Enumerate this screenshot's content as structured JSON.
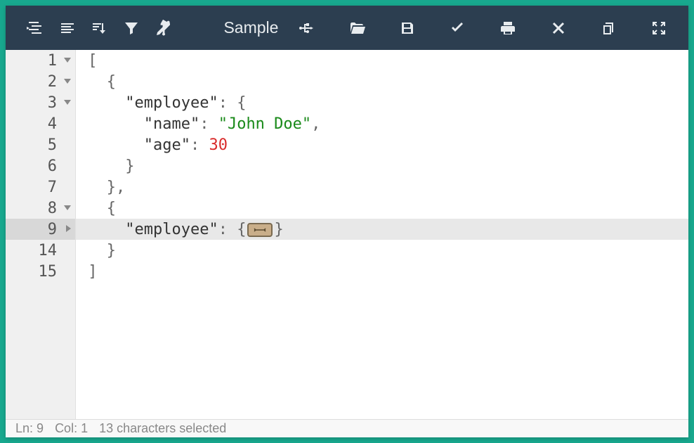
{
  "toolbar": {
    "sample_label": "Sample"
  },
  "editor": {
    "lines": [
      {
        "n": 1,
        "fold": "open"
      },
      {
        "n": 2,
        "fold": "open"
      },
      {
        "n": 3,
        "fold": "open"
      },
      {
        "n": 4,
        "fold": null
      },
      {
        "n": 5,
        "fold": null
      },
      {
        "n": 6,
        "fold": null
      },
      {
        "n": 7,
        "fold": null
      },
      {
        "n": 8,
        "fold": "open"
      },
      {
        "n": 9,
        "fold": "closed",
        "active": true
      },
      {
        "n": 14,
        "fold": null
      },
      {
        "n": 15,
        "fold": null
      }
    ],
    "tok": {
      "l1_bracket": "[",
      "l2_brace": "{",
      "l3_key": "\"employee\"",
      "l3_colon": ": ",
      "l3_brace": "{",
      "l4_key": "\"name\"",
      "l4_colon": ": ",
      "l4_val": "\"John Doe\"",
      "l4_comma": ",",
      "l5_key": "\"age\"",
      "l5_colon": ": ",
      "l5_val": "30",
      "l6_brace": "}",
      "l7_brace": "},",
      "l8_brace": "{",
      "l9_key": "\"employee\"",
      "l9_colon": ": ",
      "l9_open": "{",
      "l9_close": "}",
      "l14_brace": "}",
      "l15_bracket": "]"
    }
  },
  "status": {
    "line_label": "Ln:",
    "line_val": "9",
    "col_label": "Col:",
    "col_val": "1",
    "sel_count": "13",
    "sel_suffix": "characters selected"
  }
}
